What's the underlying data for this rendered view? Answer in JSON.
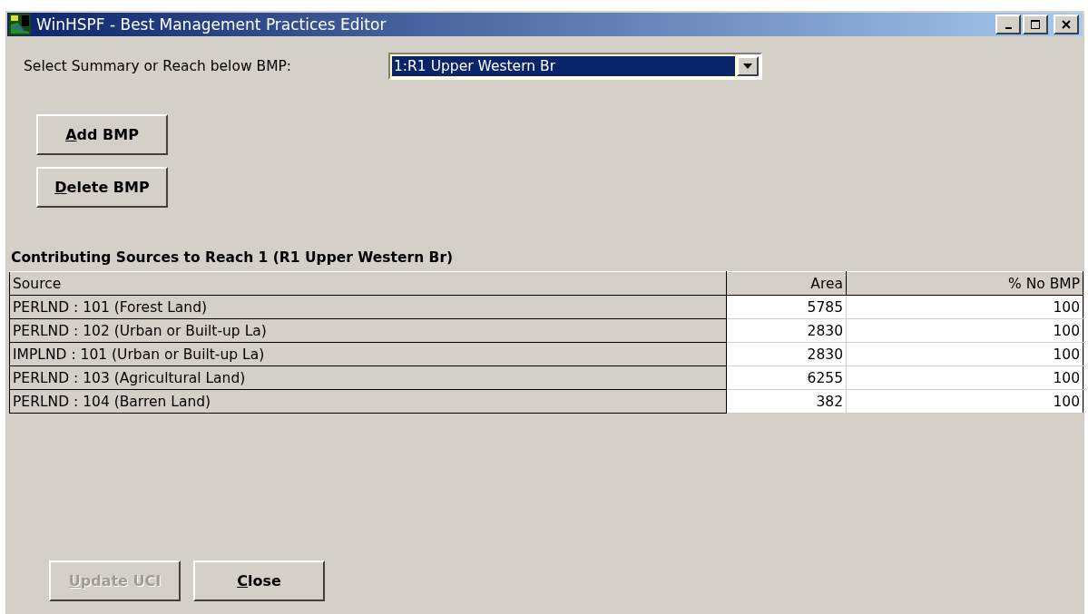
{
  "window": {
    "title": "WinHSPF - Best Management Practices Editor",
    "controls": [
      {
        "kind": "minimize"
      },
      {
        "kind": "maximize"
      },
      {
        "kind": "close"
      }
    ]
  },
  "selector": {
    "label": "Select Summary or Reach below BMP:",
    "value": "1:R1 Upper Western Br"
  },
  "bmp_buttons": [
    {
      "label": "Add BMP",
      "disabled": false
    },
    {
      "label": "Delete BMP",
      "disabled": false
    }
  ],
  "table": {
    "caption": "Contributing Sources to Reach 1 (R1 Upper Western Br)",
    "columns": [
      "Source",
      "Area",
      "% No BMP"
    ],
    "rows": [
      {
        "source": "PERLND : 101 (Forest Land)",
        "area": "5785",
        "pct": "100"
      },
      {
        "source": "PERLND : 102 (Urban or Built-up La)",
        "area": "2830",
        "pct": "100"
      },
      {
        "source": "IMPLND : 101 (Urban or Built-up La)",
        "area": "2830",
        "pct": "100"
      },
      {
        "source": "PERLND : 103 (Agricultural Land)",
        "area": "6255",
        "pct": "100"
      },
      {
        "source": "PERLND : 104 (Barren Land)",
        "area": "382",
        "pct": "100"
      }
    ]
  },
  "footer_buttons": [
    {
      "label": "Update UCI",
      "disabled": true
    },
    {
      "label": "Close",
      "disabled": false
    }
  ]
}
